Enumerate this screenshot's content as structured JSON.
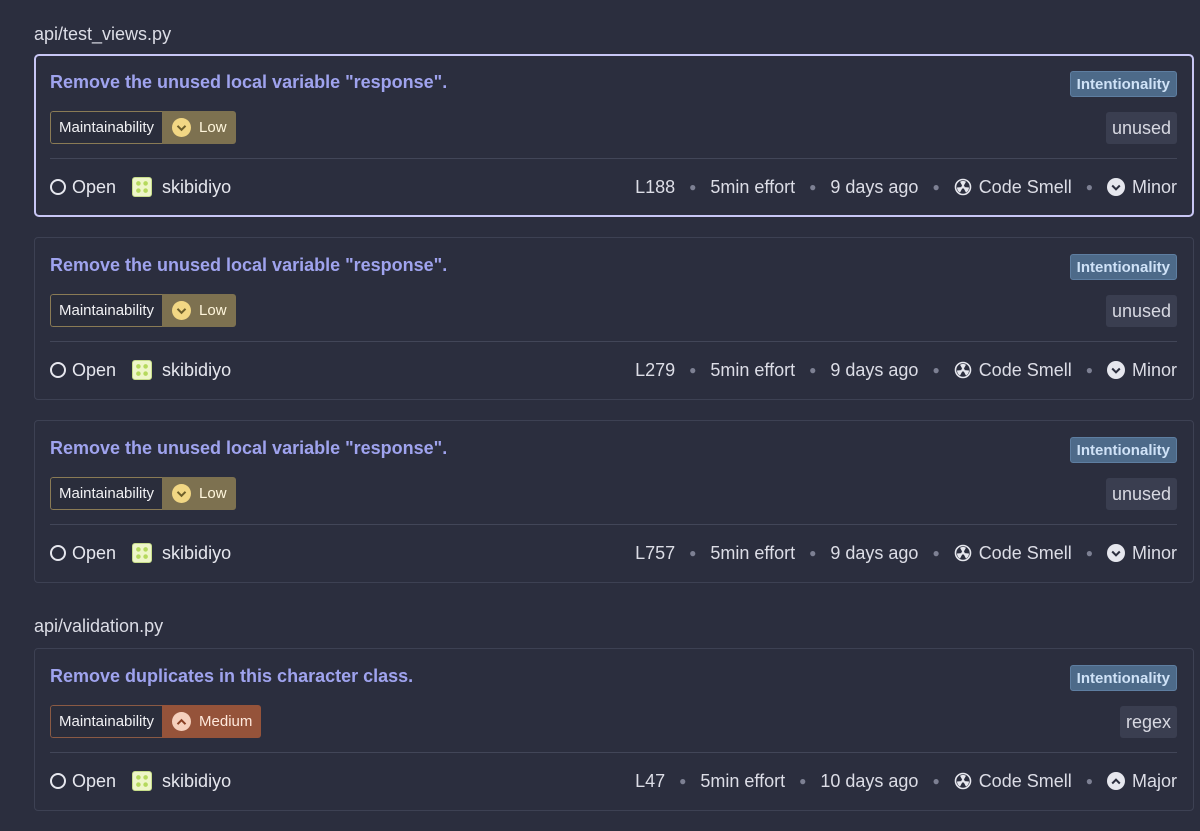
{
  "groups": [
    {
      "file": "api/test_views.py",
      "issues": [
        {
          "title": "Remove the unused local variable \"response\".",
          "attribute": "Intentionality",
          "quality": "Maintainability",
          "impact": "Low",
          "tag": "unused",
          "status": "Open",
          "assignee": "skibidiyo",
          "line": "L188",
          "effort": "5min effort",
          "age": "9 days ago",
          "type": "Code Smell",
          "severity": "Minor"
        },
        {
          "title": "Remove the unused local variable \"response\".",
          "attribute": "Intentionality",
          "quality": "Maintainability",
          "impact": "Low",
          "tag": "unused",
          "status": "Open",
          "assignee": "skibidiyo",
          "line": "L279",
          "effort": "5min effort",
          "age": "9 days ago",
          "type": "Code Smell",
          "severity": "Minor"
        },
        {
          "title": "Remove the unused local variable \"response\".",
          "attribute": "Intentionality",
          "quality": "Maintainability",
          "impact": "Low",
          "tag": "unused",
          "status": "Open",
          "assignee": "skibidiyo",
          "line": "L757",
          "effort": "5min effort",
          "age": "9 days ago",
          "type": "Code Smell",
          "severity": "Minor"
        }
      ]
    },
    {
      "file": "api/validation.py",
      "issues": [
        {
          "title": "Remove duplicates in this character class.",
          "attribute": "Intentionality",
          "quality": "Maintainability",
          "impact": "Medium",
          "tag": "regex",
          "status": "Open",
          "assignee": "skibidiyo",
          "line": "L47",
          "effort": "5min effort",
          "age": "10 days ago",
          "type": "Code Smell",
          "severity": "Major"
        }
      ]
    }
  ],
  "icons": {
    "status": "open-circle-icon",
    "assignee": "avatar",
    "type": "code-smell-icon",
    "severity_minor": "chevron-down-circle-icon",
    "severity_major": "chevron-up-circle-icon",
    "impact_low": "chevron-down-circle-icon",
    "impact_medium": "chevron-up-circle-icon"
  },
  "colors": {
    "background": "#2b2e3e",
    "title_link": "#9fa3ee",
    "impact_low": "#7d7150",
    "impact_medium": "#95533a",
    "attribute_tag": "#4d6a89",
    "selected_border": "#c8c6f4"
  }
}
